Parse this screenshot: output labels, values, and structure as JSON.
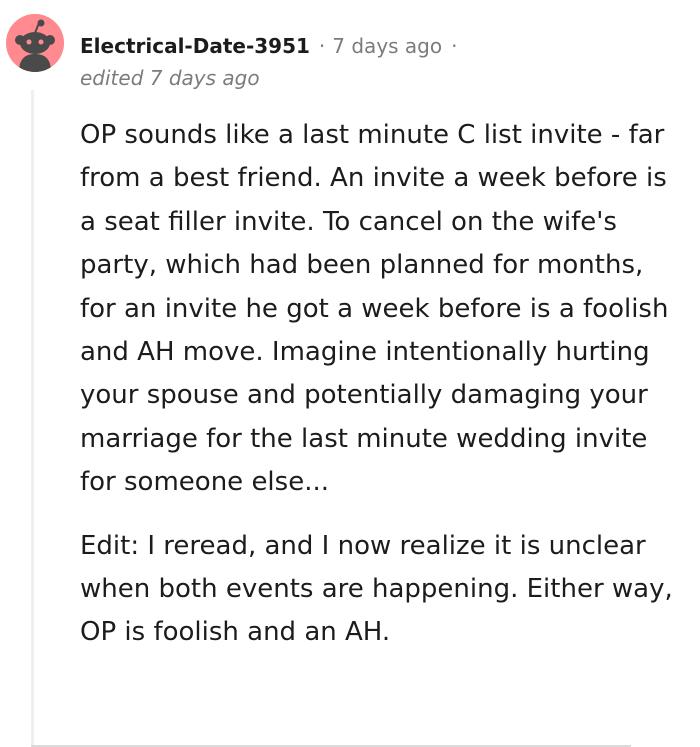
{
  "comment": {
    "author": "Electrical-Date-3951",
    "separator": "·",
    "timestamp": "7 days ago",
    "trailing_separator": "·",
    "edited_label": "edited 7 days ago",
    "paragraphs": [
      "OP sounds like a last minute C list invite - far from a best friend. An invite a week before is a seat filler invite. To cancel on the wife's party, which had been planned for months, for an invite he got a week before is a foolish and AH move. Imagine intentionally hurting your spouse and potentially damaging your marriage for the last minute wedding invite for someone else...",
      "Edit: I reread, and I now realize it is unclear when both events are happening. Either way, OP is foolish and an AH."
    ]
  },
  "colors": {
    "avatar_bg": "#ff8a8f",
    "meta_text": "#7c7c7c",
    "thread_line": "#edeff1"
  },
  "icons": {
    "avatar": "reddit-snoo-default-avatar"
  }
}
